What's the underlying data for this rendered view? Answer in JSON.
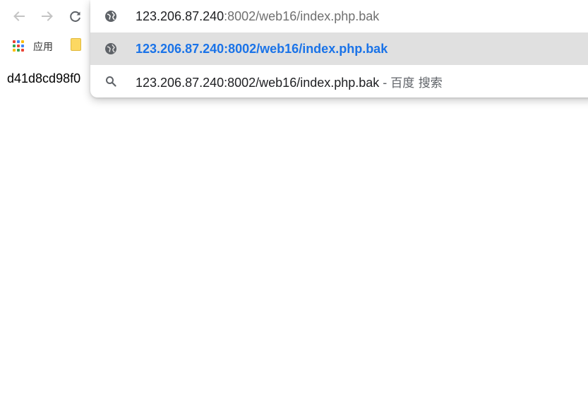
{
  "toolbar": {
    "back_icon": "arrow-left-icon",
    "forward_icon": "arrow-right-icon",
    "reload_icon": "reload-icon"
  },
  "bookmarks": {
    "apps_label": "应用",
    "apps_icon": "apps-grid-icon",
    "folder_icon": "folder-icon"
  },
  "page": {
    "visible_text": "d41d8cd98f0"
  },
  "omnibox": {
    "input": {
      "host": "123.206.87.240",
      "rest": ":8002/web16/index.php.bak",
      "icon": "globe-icon"
    },
    "suggestions": [
      {
        "type": "url",
        "text": "123.206.87.240:8002/web16/index.php.bak",
        "icon": "globe-icon",
        "selected": true
      },
      {
        "type": "search",
        "text": "123.206.87.240:8002/web16/index.php.bak",
        "separator": " - ",
        "engine": "百度 搜索",
        "icon": "search-icon"
      }
    ]
  },
  "colors": {
    "accent": "#1a73e8",
    "selected_row": "#e0e0e0",
    "icon": "#5f6368"
  }
}
